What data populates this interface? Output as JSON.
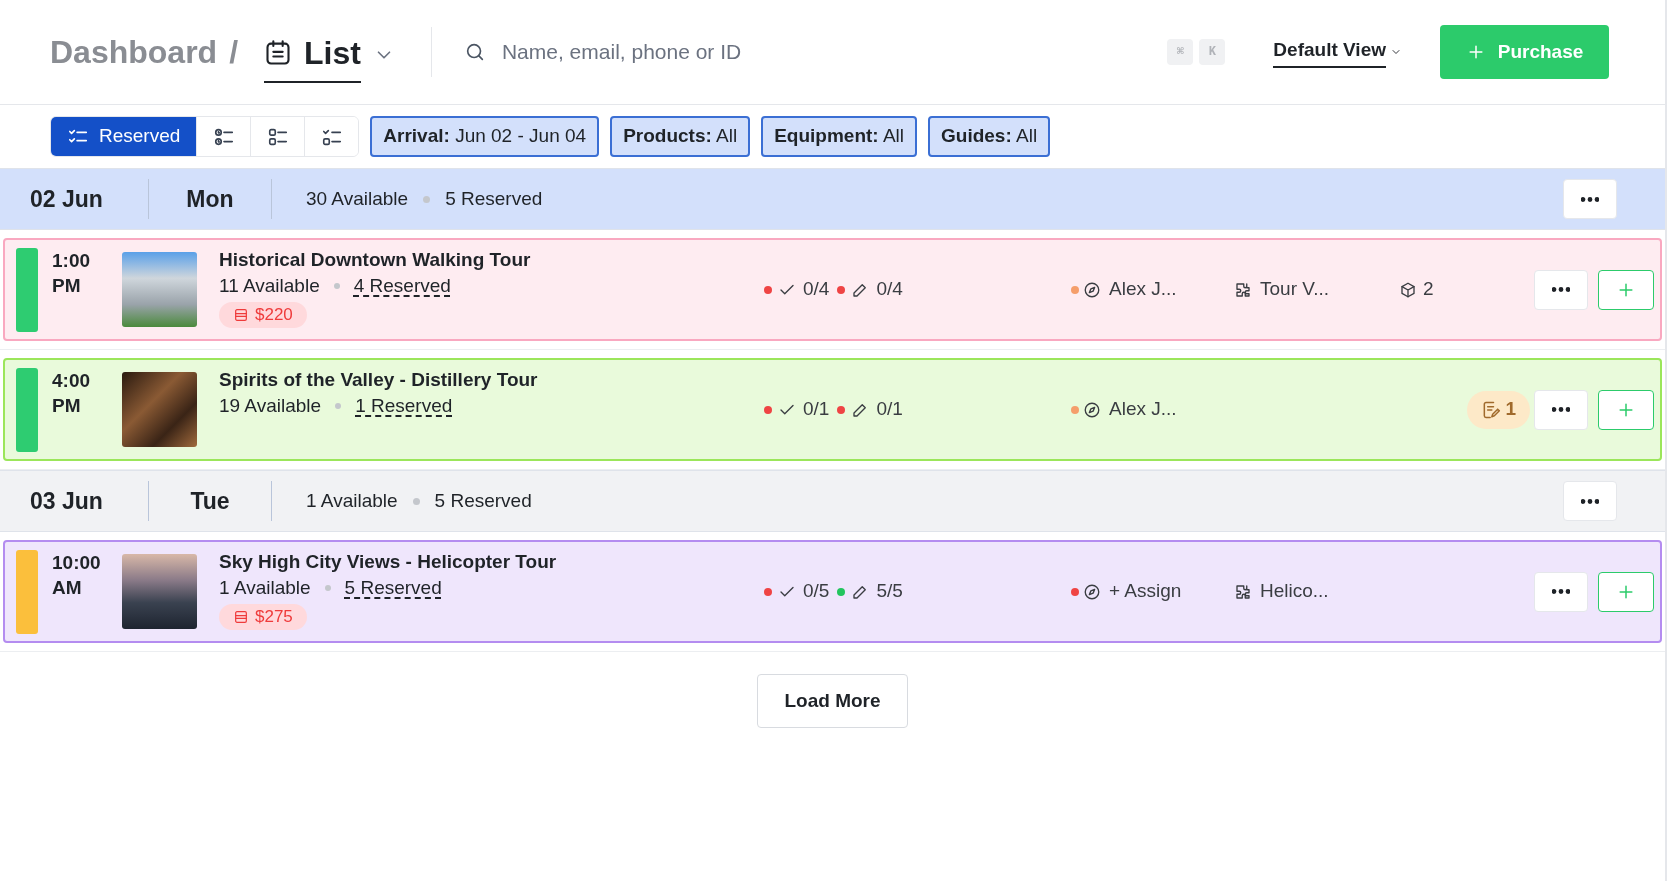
{
  "breadcrumb": {
    "root": "Dashboard",
    "separator": "/",
    "current": "List"
  },
  "search": {
    "placeholder": "Name, email, phone or ID",
    "shortcut_keys": [
      "⌘",
      "K"
    ]
  },
  "view_selector": "Default View",
  "purchase_button": "Purchase",
  "view_toggles": [
    {
      "kind": "reserved",
      "label": "Reserved",
      "selected": true
    },
    {
      "kind": "clock",
      "selected": false
    },
    {
      "kind": "list",
      "selected": false
    },
    {
      "kind": "checklist",
      "selected": false
    }
  ],
  "filters": [
    {
      "label": "Arrival:",
      "value": "Jun 02 - Jun 04"
    },
    {
      "label": "Products:",
      "value": "All"
    },
    {
      "label": "Equipment:",
      "value": "All"
    },
    {
      "label": "Guides:",
      "value": "All"
    }
  ],
  "days": [
    {
      "date": "02 Jun",
      "weekday": "Mon",
      "available": "30 Available",
      "reserved": "5 Reserved",
      "selected": true,
      "tours": [
        {
          "time": "1:00",
          "period": "PM",
          "title": "Historical Downtown Walking Tour",
          "available": "11 Available",
          "reserved": "4 Reserved",
          "price": "$220",
          "color": "#f9a8c0",
          "status": {
            "color": "#2ecc71"
          },
          "checkins": {
            "color": "#ef4444",
            "text": "0/4"
          },
          "waivers": {
            "color": "#ef4444",
            "text": "0/4"
          },
          "guide": {
            "color": "#f59e6b",
            "text": "Alex J..."
          },
          "vehicle": "Tour V...",
          "equipment": "2"
        },
        {
          "time": "4:00",
          "period": "PM",
          "title": "Spirits of the Valley - Distillery Tour",
          "available": "19 Available",
          "reserved": "1 Reserved",
          "color": "#9be65a",
          "status": {
            "color": "#2ecc71"
          },
          "checkins": {
            "color": "#ef4444",
            "text": "0/1"
          },
          "waivers": {
            "color": "#ef4444",
            "text": "0/1"
          },
          "guide": {
            "color": "#f59e6b",
            "text": "Alex J..."
          },
          "notes": "1"
        }
      ]
    },
    {
      "date": "03 Jun",
      "weekday": "Tue",
      "available": "1 Available",
      "reserved": "5 Reserved",
      "selected": false,
      "tours": [
        {
          "time": "10:00",
          "period": "AM",
          "title": "Sky High City Views - Helicopter Tour",
          "available": "1 Available",
          "reserved": "5 Reserved",
          "price": "$275",
          "color": "#b48cf0",
          "status": {
            "color": "#fbbf3c"
          },
          "checkins": {
            "color": "#ef4444",
            "text": "0/5"
          },
          "waivers": {
            "color": "#22c55e",
            "text": "5/5"
          },
          "guide": {
            "color": "#ef4444",
            "text": "+ Assign"
          },
          "vehicle": "Helico..."
        }
      ]
    }
  ],
  "load_more": "Load More"
}
